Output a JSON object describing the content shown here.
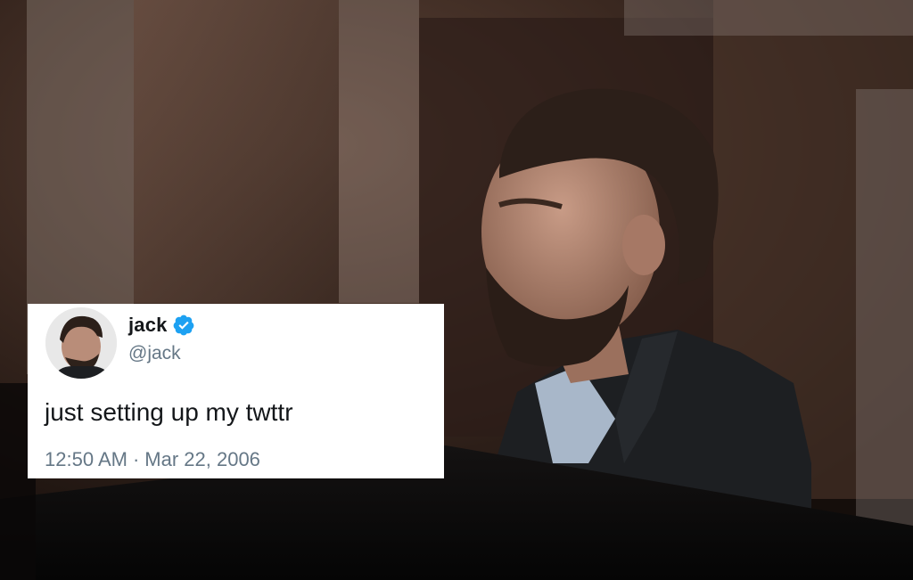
{
  "tweet": {
    "display_name": "jack",
    "verified_icon": "verified-badge-icon",
    "handle": "@jack",
    "text": "just setting up my twttr",
    "time": "12:50 AM",
    "separator": "·",
    "date": "Mar 22, 2006",
    "avatar_icon": "profile-avatar"
  },
  "colors": {
    "verified_blue": "#1da1f2",
    "name_text": "#14171a",
    "secondary_text": "#657786",
    "card_background": "#ffffff"
  }
}
